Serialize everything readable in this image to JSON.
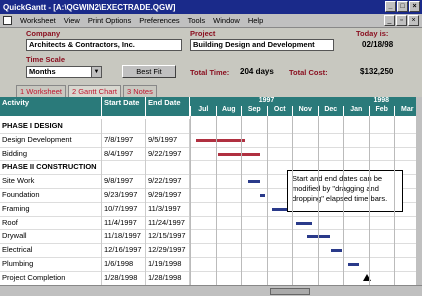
{
  "app": {
    "title": "QuickGantt - [A:\\QGWIN2\\EXECTRADE.QGW]"
  },
  "menu": [
    "Worksheet",
    "View",
    "Print Options",
    "Preferences",
    "Tools",
    "Window",
    "Help"
  ],
  "header": {
    "company_label": "Company",
    "company_value": "Architects & Contractors, Inc.",
    "project_label": "Project",
    "project_value": "Building Design and Development",
    "today_label": "Today is:",
    "today_value": "02/18/98",
    "timescale_label": "Time Scale",
    "timescale_value": "Months",
    "bestfit_label": "Best Fit",
    "total_time_label": "Total Time:",
    "total_time_value": "204 days",
    "total_cost_label": "Total Cost:",
    "total_cost_value": "$132,250"
  },
  "tabs": [
    "1 Worksheet",
    "2 Gantt Chart",
    "3 Notes"
  ],
  "columns": {
    "activity": "Activity",
    "start": "Start Date",
    "end": "End Date"
  },
  "years": [
    "1997",
    "1998"
  ],
  "months": [
    "Jul",
    "Aug",
    "Sep",
    "Oct",
    "Nov",
    "Dec",
    "Jan",
    "Feb",
    "Mar"
  ],
  "rows": [
    {
      "activity": "PHASE I DESIGN",
      "start": "",
      "end": "",
      "phase": true
    },
    {
      "activity": "Design Development",
      "start": "7/8/1997",
      "end": "9/5/1997",
      "phase": false
    },
    {
      "activity": "Bidding",
      "start": "8/4/1997",
      "end": "9/22/1997",
      "phase": false
    },
    {
      "activity": "PHASE II CONSTRUCTION",
      "start": "",
      "end": "",
      "phase": true
    },
    {
      "activity": "Site Work",
      "start": "9/8/1997",
      "end": "9/22/1997",
      "phase": false
    },
    {
      "activity": "Foundation",
      "start": "9/23/1997",
      "end": "9/29/1997",
      "phase": false
    },
    {
      "activity": "Framing",
      "start": "10/7/1997",
      "end": "11/3/1997",
      "phase": false
    },
    {
      "activity": "Roof",
      "start": "11/4/1997",
      "end": "11/24/1997",
      "phase": false
    },
    {
      "activity": "Drywall",
      "start": "11/18/1997",
      "end": "12/15/1997",
      "phase": false
    },
    {
      "activity": "Electrical",
      "start": "12/16/1997",
      "end": "12/29/1997",
      "phase": false
    },
    {
      "activity": "Plumbing",
      "start": "1/6/1998",
      "end": "1/19/1998",
      "phase": false
    },
    {
      "activity": "Project Completion",
      "start": "1/28/1998",
      "end": "1/28/1998",
      "phase": false
    }
  ],
  "callout": "Start and end dates can be modified by \"dragging and dropping\" elapsed time bars.",
  "colors": {
    "title_bar": "#1a2a8a",
    "grid_header": "#2a7a7a",
    "label": "#8a1020",
    "bar_red": "#b03040",
    "bar_blue": "#2a3a8a"
  }
}
